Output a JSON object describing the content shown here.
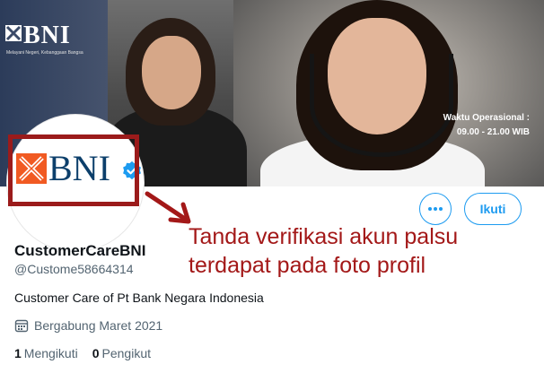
{
  "banner": {
    "logo_text": "BNI",
    "logo_tagline": "Melayani Negeri, Kebanggaan Bangsa",
    "hours_label": "Waktu Operasional :",
    "hours_value": "09.00 - 21.00 WIB"
  },
  "avatar": {
    "logo_text": "BNI"
  },
  "actions": {
    "more_label": "•••",
    "follow_label": "Ikuti"
  },
  "annotation": {
    "line1": "Tanda verifikasi akun palsu",
    "line2": "terdapat pada foto profil"
  },
  "profile": {
    "display_name": "CustomerCareBNI",
    "handle": "@Custome58664314",
    "bio": "Customer Care of Pt Bank Negara Indonesia",
    "joined": "Bergabung Maret 2021",
    "following_count": "1",
    "following_label": "Mengikuti",
    "followers_count": "0",
    "followers_label": "Pengikut"
  },
  "colors": {
    "accent": "#1d9bf0",
    "brand_orange": "#f15a22",
    "brand_navy": "#0c3f6b",
    "annotation_red": "#a31818"
  }
}
